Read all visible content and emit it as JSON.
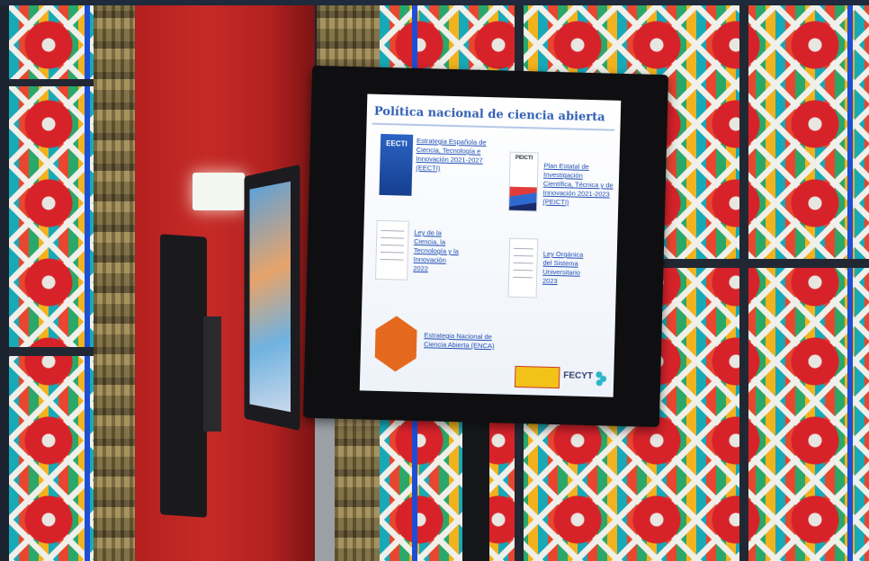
{
  "slide": {
    "title": "Política nacional de ciencia abierta",
    "items": [
      {
        "label_lines": [
          "Estrategia Española de",
          "Ciencia, Tecnología e",
          "Innovación 2021-2027",
          "(EECTI)"
        ],
        "cover": "EECTI"
      },
      {
        "label_lines": [
          "Plan Estatal de",
          "Investigación",
          "Científica, Técnica y de",
          "Innovación 2021-2023",
          "(PEICTI)"
        ],
        "cover": "PEICTI"
      },
      {
        "label_lines": [
          "Ley de la",
          "Ciencia, la",
          "Tecnología y la",
          "Innovación",
          "2022"
        ]
      },
      {
        "label_lines": [
          "Ley Orgánica",
          "del Sistema",
          "Universitario",
          "2023"
        ]
      },
      {
        "label_lines": [
          "Estrategia Nacional de",
          "Ciencia Abierta (ENCA)"
        ]
      }
    ],
    "footer": {
      "logo_text": "FECYT"
    }
  },
  "colors": {
    "title": "#2f5fb2",
    "link": "#1f4fb3",
    "wall": "#c62a27",
    "glass_red": "#d8222a",
    "glass_teal": "#17a9b8",
    "hexagon": "#e4691f"
  }
}
